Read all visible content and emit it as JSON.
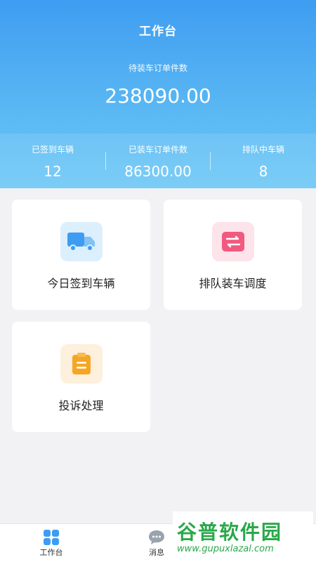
{
  "header": {
    "title": "工作台",
    "pending_label": "待装车订单件数",
    "pending_value": "238090.00"
  },
  "stats": [
    {
      "label": "已签到车辆",
      "value": "12"
    },
    {
      "label": "已装车订单件数",
      "value": "86300.00"
    },
    {
      "label": "排队中车辆",
      "value": "8"
    }
  ],
  "cards": [
    {
      "label": "今日签到车辆",
      "icon": "truck-icon"
    },
    {
      "label": "排队装车调度",
      "icon": "swap-icon"
    },
    {
      "label": "投诉处理",
      "icon": "clipboard-icon"
    }
  ],
  "tabbar": {
    "items": [
      {
        "label": "工作台",
        "icon": "grid-icon"
      },
      {
        "label": "消息",
        "icon": "chat-icon"
      }
    ]
  },
  "watermark": {
    "title": "谷普软件园",
    "url": "www.gupuxlazal.com"
  },
  "colors": {
    "header_top": "#3f9df2",
    "header_bottom": "#6cc8f5",
    "truck_bg": "#dceffc",
    "truck": "#3d9df2",
    "swap_bg": "#fde3ea",
    "swap": "#f2597f",
    "clipboard_bg": "#fdf0dc",
    "clipboard": "#f6a623",
    "watermark_green": "#2aa84a"
  }
}
